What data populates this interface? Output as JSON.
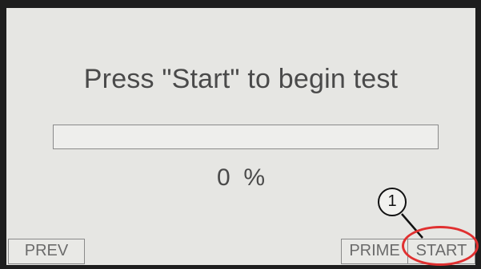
{
  "screen": {
    "prompt": "Press \"Start\" to begin test",
    "progress": {
      "percent_value": "0",
      "percent_symbol": "%",
      "fill_fraction": 0
    }
  },
  "buttons": {
    "prev_label": "PREV",
    "prime_label": "PRIME",
    "start_label": "START"
  },
  "annotation": {
    "callout_number": "1",
    "highlight_color": "#e03030"
  }
}
